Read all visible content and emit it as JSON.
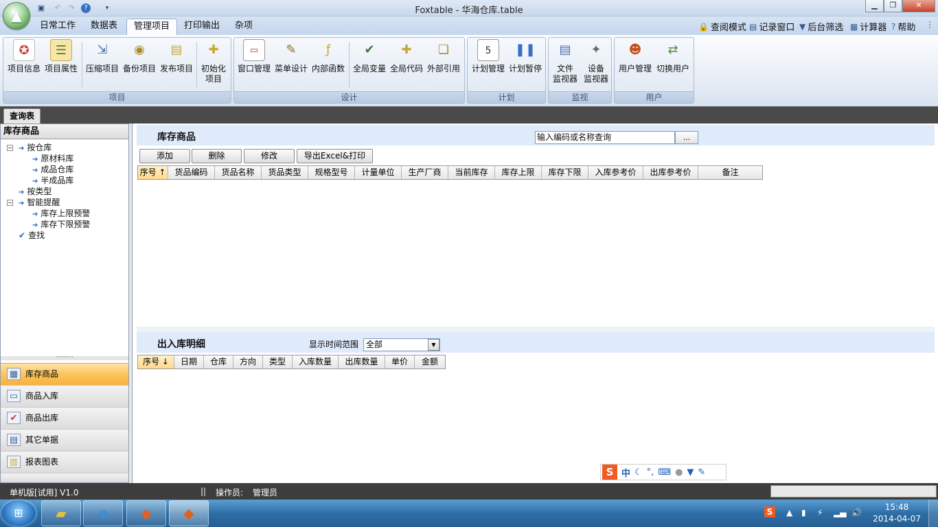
{
  "window": {
    "title": "Foxtable - 华海仓库.table",
    "qat_icons": [
      "save-icon",
      "undo-icon",
      "redo-icon",
      "help-icon",
      "customize-icon"
    ],
    "controls": [
      "minimize",
      "restore",
      "close"
    ]
  },
  "menu_tabs": [
    "日常工作",
    "数据表",
    "管理项目",
    "打印输出",
    "杂项"
  ],
  "active_menu_tab": "管理项目",
  "right_tools": {
    "query_mode": "查阅模式",
    "record_window": "记录窗口",
    "background_filter": "后台筛选",
    "calculator": "计算器",
    "help": "帮助"
  },
  "ribbon": {
    "groups": [
      {
        "caption": "项目",
        "buttons": [
          "项目信息",
          "项目属性",
          "压缩项目",
          "备份项目",
          "发布项目",
          "初始化项目"
        ]
      },
      {
        "caption": "设计",
        "buttons": [
          "窗口管理",
          "菜单设计",
          "内部函数",
          "全局变量",
          "全局代码",
          "外部引用"
        ]
      },
      {
        "caption": "计划",
        "buttons": [
          "计划管理",
          "计划暂停"
        ]
      },
      {
        "caption": "监视",
        "buttons": [
          "文件监视器",
          "设备监视器"
        ]
      },
      {
        "caption": "用户",
        "buttons": [
          "用户管理",
          "切换用户"
        ]
      }
    ],
    "two_line_labels": {
      "init": [
        "初始化",
        "项目"
      ],
      "file_monitor": [
        "文件",
        "监视器"
      ],
      "device_monitor": [
        "设备",
        "监视器"
      ]
    }
  },
  "doc_tab": "查询表",
  "left_panel": {
    "title": "库存商品",
    "tree": {
      "by_warehouse": "按仓库",
      "raw_material": "原材料库",
      "finished_goods": "成品仓库",
      "semi_finished": "半成品库",
      "by_type": "按类型",
      "smart_alert": "智能提醒",
      "upper_alert": "库存上限预警",
      "lower_alert": "库存下限预警",
      "search": "查找"
    },
    "splitter": "·········",
    "nav": [
      "库存商品",
      "商品入库",
      "商品出库",
      "其它单据",
      "报表图表"
    ]
  },
  "main": {
    "stock_section": {
      "title": "库存商品",
      "search_value": "输入编码或名称查询",
      "search_button": "...",
      "buttons": [
        "添加",
        "删除",
        "修改",
        "导出Excel&打印"
      ],
      "columns": [
        "序号 ↑",
        "货品编码",
        "货品名称",
        "货品类型",
        "规格型号",
        "计量单位",
        "生产厂商",
        "当前库存",
        "库存上限",
        "库存下限",
        "入库参考价",
        "出库参考价",
        "备注"
      ]
    },
    "detail_section": {
      "title": "出入库明细",
      "range_label": "显示时间范围",
      "range_value": "全部",
      "columns": [
        "序号 ↓",
        "日期",
        "仓库",
        "方向",
        "类型",
        "入库数量",
        "出库数量",
        "单价",
        "金额"
      ]
    }
  },
  "ime": {
    "logo": "S",
    "mode": "中",
    "icons": [
      "moon-icon",
      "punct-icon",
      "keyboard-icon",
      "user-icon",
      "shirt-icon",
      "wrench-icon"
    ]
  },
  "status": {
    "edition": "单机版[试用] V1.0",
    "separator": "||",
    "operator_label": "操作员:",
    "operator": "管理员"
  },
  "taskbar": {
    "time": "15:48",
    "date": "2014-04-07"
  }
}
